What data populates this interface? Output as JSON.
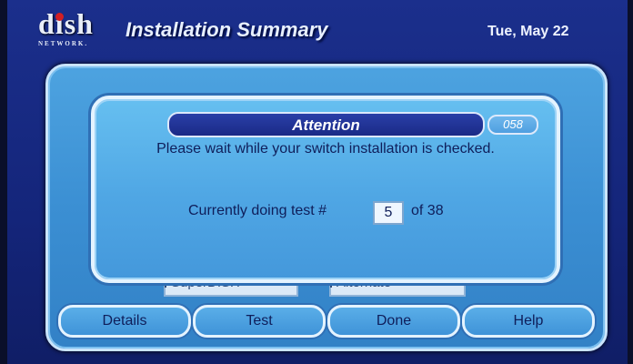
{
  "header": {
    "logo_text": "dish",
    "logo_subtext": "NETWORK.",
    "title": "Installation Summary",
    "date": "Tue, May 22"
  },
  "background_options": [
    {
      "label": "SuperDISH"
    },
    {
      "label": "Alternate"
    }
  ],
  "dialog": {
    "title": "Attention",
    "code": "058",
    "message": "Please wait while your switch installation is checked.",
    "progress_label": "Currently doing test #",
    "current_test": "5",
    "of_text": "of 38",
    "total_tests": 38
  },
  "buttons": [
    {
      "label": "Details"
    },
    {
      "label": "Test"
    },
    {
      "label": "Done"
    },
    {
      "label": "Help"
    }
  ],
  "colors": {
    "header_bg": "#1b2f8c",
    "panel_bg": "#4da3e0",
    "attention_bar": "#1a2a86",
    "logo_accent": "#d21f24",
    "text_dark": "#0f1e5a"
  }
}
